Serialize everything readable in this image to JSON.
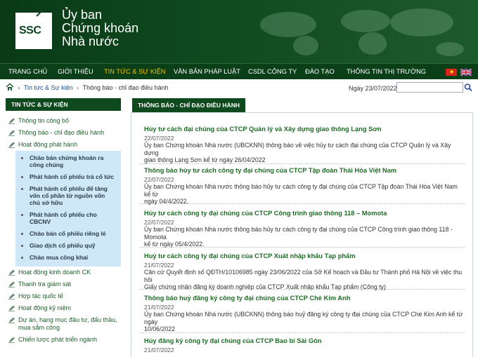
{
  "header": {
    "logo_text": "SSC",
    "org_lines": [
      "Ủy ban",
      "Chứng khoán",
      "Nhà nước"
    ]
  },
  "nav": {
    "items": [
      {
        "label": "TRANG CHỦ",
        "active": false
      },
      {
        "label": "GIỚI THIỆU",
        "active": false
      },
      {
        "label": "TIN TỨC & SỰ KIỆN",
        "active": true
      },
      {
        "label": "VĂN BẢN PHÁP LUẬT",
        "active": false
      },
      {
        "label": "CSDL CÔNG TY",
        "active": false
      },
      {
        "label": "ĐÀO TẠO",
        "active": false
      },
      {
        "label": "THÔNG TIN THỊ TRƯỜNG",
        "active": false
      }
    ],
    "active_color": "#f2c200"
  },
  "breadcrumb": {
    "items": [
      "Tin tức & Sự kiện",
      "Thông báo - chỉ đạo điều hành"
    ]
  },
  "date_label": "Ngày 23/07/2022",
  "search": {
    "value": ""
  },
  "sidebar": {
    "heading": "TIN TỨC & SỰ KIỆN",
    "items_top": [
      "Thông tin công bố",
      "Thông báo - chỉ đạo điều hành",
      "Hoạt động phát hành"
    ],
    "subitems": [
      "Chào bán chứng khoán ra công chúng",
      "Phát hành cổ phiếu trả cổ tức",
      "Phát hành cổ phiếu để tăng vốn cổ phần từ nguồn vốn chủ sở hữu",
      "Phát hành cổ phiếu cho CBCNV",
      "Chào bán cổ phiếu riêng lẻ",
      "Giao dịch cổ phiếu quỹ",
      "Chào mua công khai"
    ],
    "items_bottom": [
      "Hoạt động kinh doanh CK",
      "Thanh tra giám sát",
      "Hợp tác quốc tế",
      "Hoạt động kỷ niệm",
      "Dự án, hạng mục đầu tư, đấu thầu, mua sắm công",
      "Chiến lược phát triển ngành"
    ]
  },
  "main": {
    "tab_label": "THÔNG BÁO - CHỈ ĐẠO ĐIỀU HÀNH",
    "articles": [
      {
        "title": "Hủy tư cách đại chúng của CTCP Quản lý và Xây dựng giao thông Lạng Sơn",
        "date": "22/07/2022",
        "desc": [
          "Ủy ban Chứng khoán Nhà nước (UBCKNN) thông báo về việc hủy tư cách đại chúng của CTCP Quản lý và Xây dựng",
          "giao thông Lạng Sơn kể từ ngày 26/04/2022"
        ]
      },
      {
        "title": "Thông báo hủy tư cách công ty đại chúng của CTCP Tập đoàn Thái Hòa Việt Nam",
        "date": "22/07/2022",
        "desc": [
          "Ủy ban Chứng khoán Nhà nước thông báo hủy tư cách công ty đại chúng của CTCP Tập đoàn Thái Hòa Việt Nam kể từ",
          "ngày 04/4/2022."
        ]
      },
      {
        "title": "Hủy tư cách công ty đại chúng của CTCP Công trình giao thông 118 – Momota",
        "date": "22/07/2022",
        "desc": [
          "Ủy ban Chứng khoán Nhà nước thông báo hủy tư cách công ty đại chúng của CTCP Công trình giao thông 118 - Momota",
          "kể từ ngày 05/4/2022."
        ]
      },
      {
        "title": "Huỷ tư cách công ty đại chúng của CTCP Xuất nhập khẩu Tạp phẩm",
        "date": "21/07/2022",
        "desc": [
          "Căn cứ Quyết định số QĐTH/10106985 ngày 23/06/2022 của Sở Kế hoạch và Đầu tư Thành phố Hà Nội về việc thu hồi",
          "Giấy chứng nhận đăng ký doanh nghiệp của CTCP Xuất nhập khẩu Tạp phẩm (Công ty)"
        ]
      },
      {
        "title": "Thông báo huỷ đăng ký công ty đại chúng của CTCP Chè Kim Anh",
        "date": "21/07/2022",
        "desc": [
          "Ủy ban Chứng khoán Nhà nước (UBCKNN) thông báo huỷ đăng ký công ty đại chúng của CTCP Chè Kim Anh kể từ ngày",
          "10/06/2022"
        ]
      },
      {
        "title": "Hủy đăng ký công ty đại chúng của CTCP Bao bì Sài Gòn",
        "date": "21/07/2022",
        "desc": []
      }
    ]
  },
  "colors": {
    "brand_green": "#0f4a1f",
    "link_green": "#1d6b24",
    "submenu_bg": "#cfe8f7"
  }
}
